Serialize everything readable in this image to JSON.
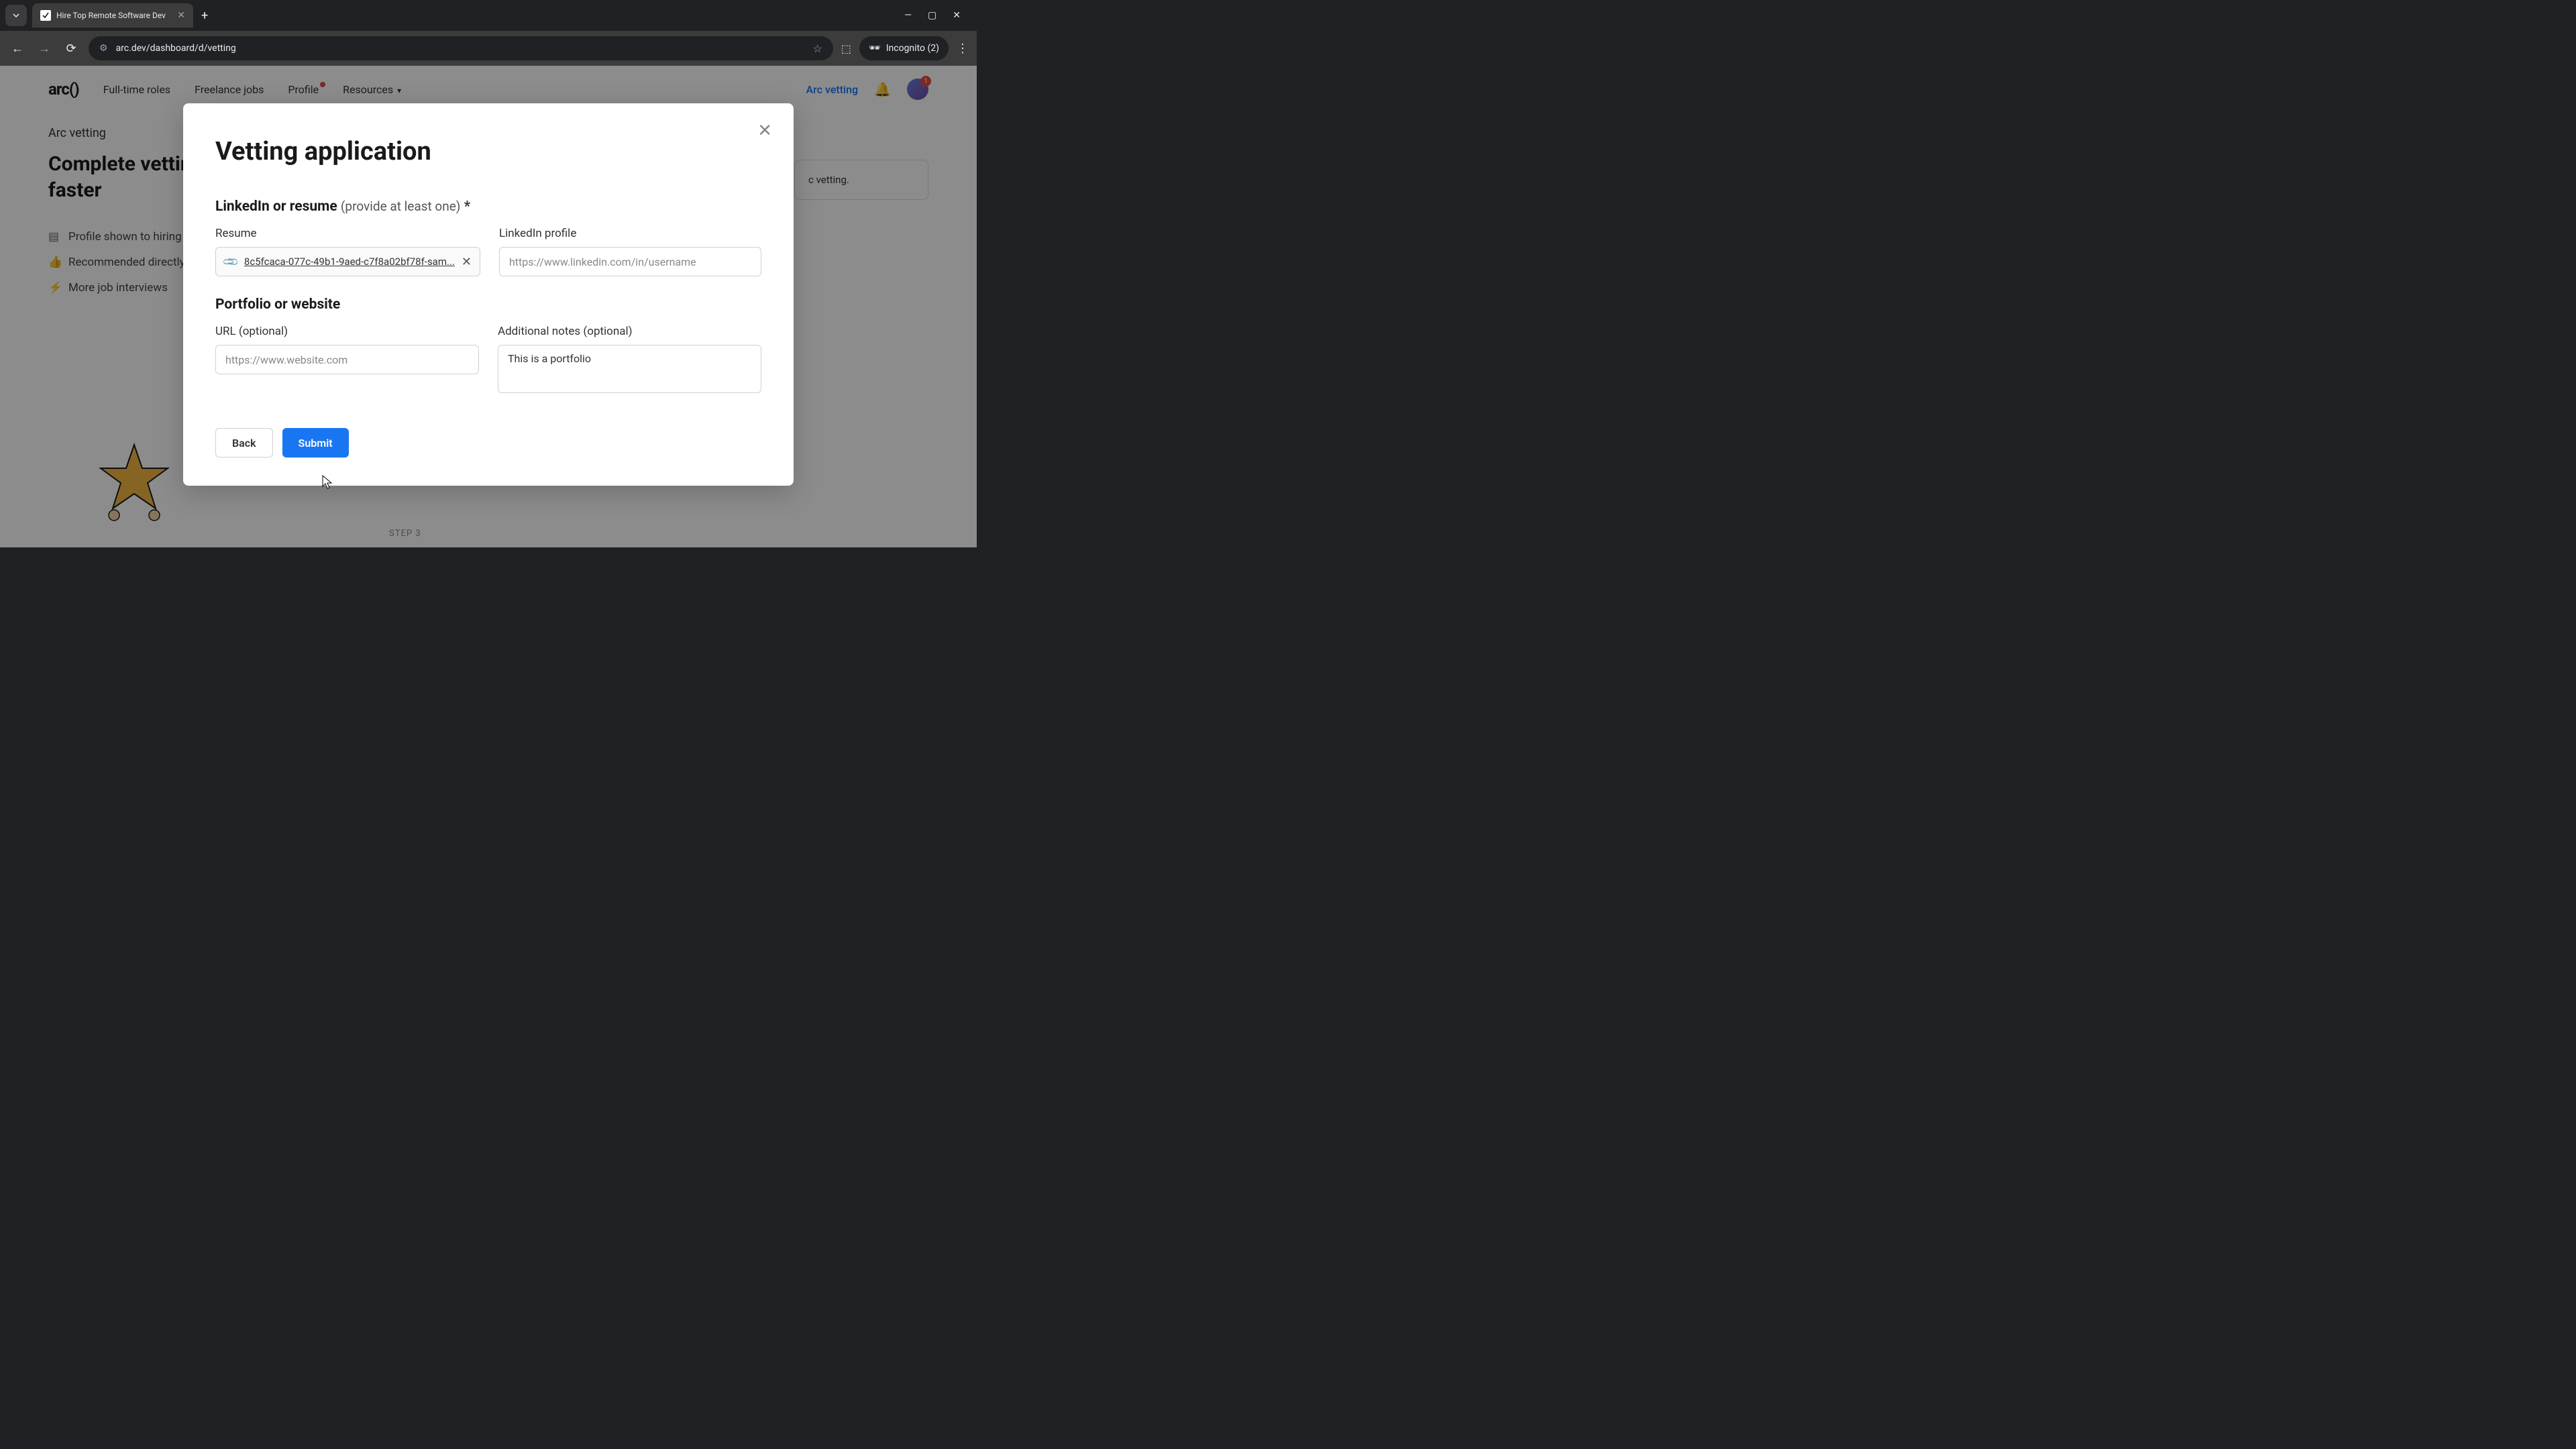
{
  "browser": {
    "tab_title": "Hire Top Remote Software Dev",
    "url": "arc.dev/dashboard/d/vetting",
    "incognito_label": "Incognito (2)"
  },
  "header": {
    "logo": "arc()",
    "nav": {
      "fulltime": "Full-time roles",
      "freelance": "Freelance jobs",
      "profile": "Profile",
      "resources": "Resources"
    },
    "vetting_link": "Arc vetting",
    "avatar_badge": "1"
  },
  "page": {
    "breadcrumb": "Arc vetting",
    "headline": "Complete vetting and get hired 2x faster",
    "benefits": {
      "b1": "Profile shown to hiring",
      "b2": "Recommended directly",
      "b3": "More job interviews"
    },
    "side_card_text": "c vetting.",
    "step_label": "STEP 3"
  },
  "modal": {
    "title": "Vetting application",
    "section1": {
      "heading": "LinkedIn or resume",
      "hint": "(provide at least one)",
      "required": "*",
      "resume_label": "Resume",
      "resume_filename": "8c5fcaca-077c-49b1-9aed-c7f8a02bf78f-sam...",
      "linkedin_label": "LinkedIn profile",
      "linkedin_placeholder": "https://www.linkedin.com/in/username"
    },
    "section2": {
      "heading": "Portfolio or website",
      "url_label": "URL (optional)",
      "url_placeholder": "https://www.website.com",
      "notes_label": "Additional notes (optional)",
      "notes_value": "This is a portfolio"
    },
    "actions": {
      "back": "Back",
      "submit": "Submit"
    }
  }
}
